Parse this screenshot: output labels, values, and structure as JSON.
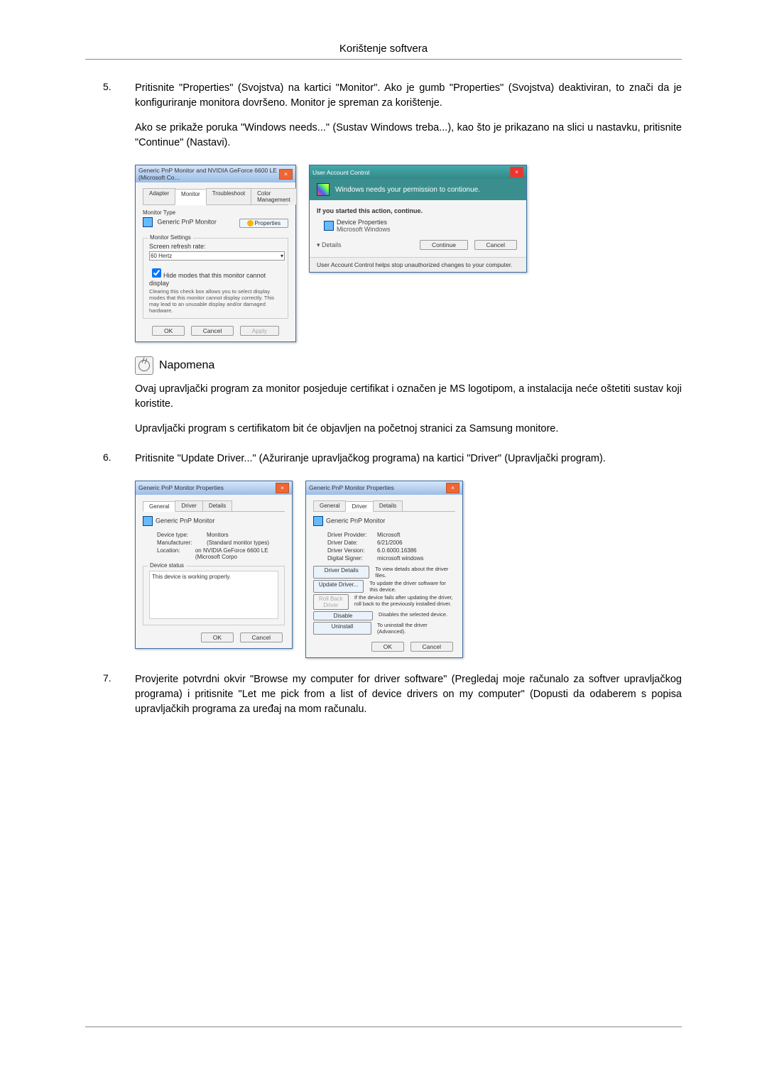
{
  "header": {
    "title": "Korištenje softvera"
  },
  "steps": [
    {
      "num": "5.",
      "text1": "Pritisnite \"Properties\" (Svojstva) na kartici \"Monitor\". Ako je gumb \"Properties\" (Svojstva) deaktiviran, to znači da je konfiguriranje monitora dovršeno. Monitor je spreman za korištenje.",
      "text2": "Ako se prikaže poruka \"Windows needs...\" (Sustav Windows treba...), kao što je prikazano na slici u nastavku, pritisnite \"Continue\" (Nastavi)."
    },
    {
      "num": "6.",
      "text1": "Pritisnite \"Update Driver...\" (Ažuriranje upravljačkog programa) na kartici \"Driver\" (Upravljački program)."
    },
    {
      "num": "7.",
      "text1": "Provjerite potvrdni okvir \"Browse my computer for driver software\" (Pregledaj moje računalo za softver upravljačkog programa) i pritisnite \"Let me pick from a list of device drivers on my computer\" (Dopusti da odaberem s popisa upravljačkih programa za uređaj na mom računalu."
    }
  ],
  "note": {
    "title": "Napomena",
    "p1": "Ovaj upravljački program za monitor posjeduje certifikat i označen je MS logotipom, a instalacija neće oštetiti sustav koji koristite.",
    "p2": "Upravljački program s certifikatom bit će objavljen na početnoj stranici za Samsung monitore."
  },
  "win1": {
    "title": "Generic PnP Monitor and NVIDIA GeForce 6600 LE (Microsoft Co...",
    "tabs": [
      "Adapter",
      "Monitor",
      "Troubleshoot",
      "Color Management"
    ],
    "monitor_type_label": "Monitor Type",
    "monitor_name": "Generic PnP Monitor",
    "properties": "Properties",
    "settings_label": "Monitor Settings",
    "refresh_label": "Screen refresh rate:",
    "refresh_val": "60 Hertz",
    "hide_chk": "Hide modes that this monitor cannot display",
    "hide_help": "Clearing this check box allows you to select display modes that this monitor cannot display correctly. This may lead to an unusable display and/or damaged hardware.",
    "ok": "OK",
    "cancel": "Cancel",
    "apply": "Apply"
  },
  "uac": {
    "title": "User Account Control",
    "msg": "Windows needs your permission to contionue.",
    "started": "If you started this action, continue.",
    "item": "Device Properties",
    "sub": "Microsoft Windows",
    "details": "Details",
    "continue": "Continue",
    "cancel": "Cancel",
    "footer": "User Account Control helps stop unauthorized changes to your computer."
  },
  "drvgen": {
    "title": "Generic PnP Monitor Properties",
    "tabs": [
      "General",
      "Driver",
      "Details"
    ],
    "name": "Generic PnP Monitor",
    "devtype_k": "Device type:",
    "devtype_v": "Monitors",
    "mfr_k": "Manufacturer:",
    "mfr_v": "(Standard monitor types)",
    "loc_k": "Location:",
    "loc_v": "on NVIDIA GeForce 6600 LE (Microsoft Corpo",
    "status_label": "Device status",
    "status": "This device is working properly.",
    "ok": "OK",
    "cancel": "Cancel"
  },
  "drvtab": {
    "title": "Generic PnP Monitor Properties",
    "tabs": [
      "General",
      "Driver",
      "Details"
    ],
    "name": "Generic PnP Monitor",
    "prov_k": "Driver Provider:",
    "prov_v": "Microsoft",
    "date_k": "Driver Date:",
    "date_v": "6/21/2006",
    "ver_k": "Driver Version:",
    "ver_v": "6.0.6000.16386",
    "signer_k": "Digital Signer:",
    "signer_v": "microsoft windows",
    "b1": "Driver Details",
    "b1t": "To view details about the driver files.",
    "b2": "Update Driver...",
    "b2t": "To update the driver software for this device.",
    "b3": "Roll Back Driver",
    "b3t": "If the device fails after updating the driver, roll back to the previously installed driver.",
    "b4": "Disable",
    "b4t": "Disables the selected device.",
    "b5": "Uninstall",
    "b5t": "To uninstall the driver (Advanced).",
    "ok": "OK",
    "cancel": "Cancel"
  }
}
